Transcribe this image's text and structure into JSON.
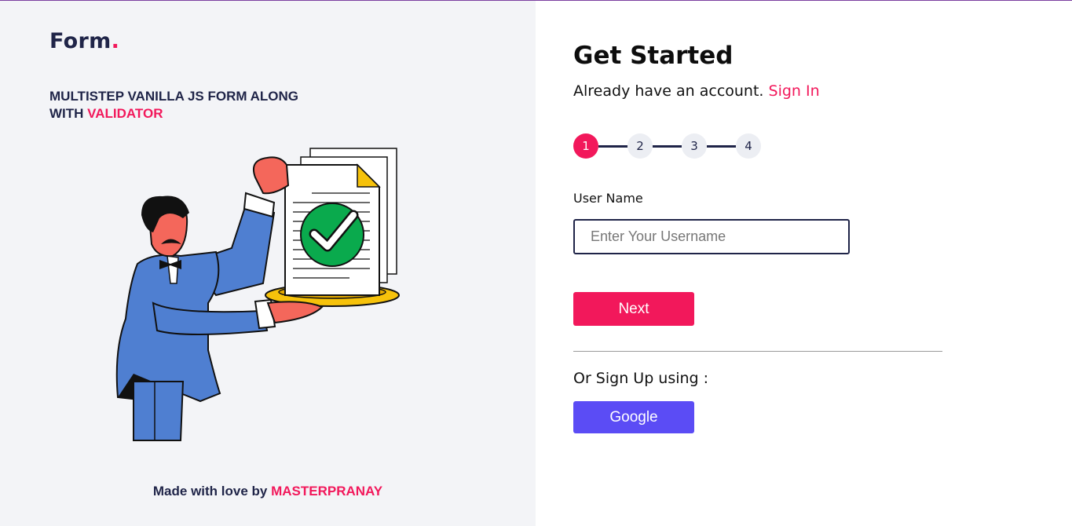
{
  "brand": {
    "name": "Form",
    "dot": "."
  },
  "tagline": {
    "line1": "MULTISTEP VANILLA JS FORM ALONG",
    "line2_prefix": "WITH ",
    "line2_accent": "VALIDATOR"
  },
  "footer": {
    "prefix": "Made with love by ",
    "author": "MASTERPRANAY"
  },
  "form": {
    "title": "Get Started",
    "subtitle_text": "Already have an account. ",
    "signin_link": "Sign In",
    "steps": [
      "1",
      "2",
      "3",
      "4"
    ],
    "active_step": 1,
    "username_label": "User Name",
    "username_placeholder": "Enter Your Username",
    "username_value": "",
    "next_label": "Next",
    "or_text": "Or Sign Up using :",
    "google_label": "Google"
  },
  "colors": {
    "accent": "#f2185b",
    "navy": "#1f2448",
    "google": "#5b4cf5",
    "panel": "#f3f4f7"
  },
  "icons": {
    "illustration": "butler-presenting-approved-document-illustration"
  }
}
